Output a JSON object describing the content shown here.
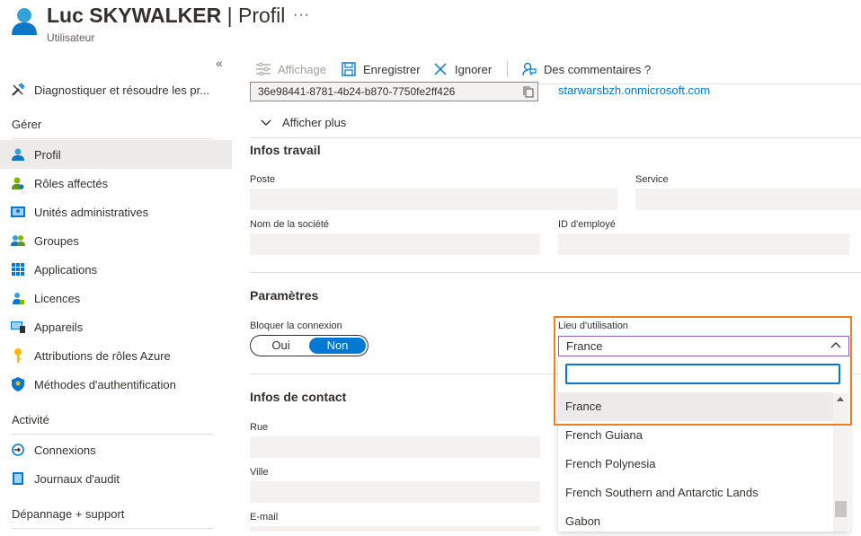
{
  "header": {
    "name": "Luc SKYWALKER",
    "separator": " | ",
    "section": "Profil",
    "subtitle": "Utilisateur",
    "more": "···"
  },
  "sidebar": {
    "collapse": "«",
    "top_item": {
      "label": "Diagnostiquer et résoudre les pr...",
      "icon": "wrench-icon"
    },
    "sections": [
      {
        "title": "Gérer"
      },
      {
        "title": "Activité"
      },
      {
        "title": "Dépannage + support"
      }
    ],
    "manage_items": [
      {
        "label": "Profil",
        "icon": "user-icon",
        "active": true
      },
      {
        "label": "Rôles affectés",
        "icon": "role-icon"
      },
      {
        "label": "Unités administratives",
        "icon": "admin-units-icon"
      },
      {
        "label": "Groupes",
        "icon": "groups-icon"
      },
      {
        "label": "Applications",
        "icon": "apps-grid-icon"
      },
      {
        "label": "Licences",
        "icon": "license-icon"
      },
      {
        "label": "Appareils",
        "icon": "device-icon"
      },
      {
        "label": "Attributions de rôles Azure",
        "icon": "key-icon"
      },
      {
        "label": "Méthodes d'authentification",
        "icon": "shield-icon"
      }
    ],
    "activity_items": [
      {
        "label": "Connexions",
        "icon": "signin-icon"
      },
      {
        "label": "Journaux d'audit",
        "icon": "audit-log-icon"
      }
    ]
  },
  "toolbar": {
    "view_label": "Affichage",
    "save_label": "Enregistrer",
    "discard_label": "Ignorer",
    "feedback_label": "Des commentaires ?"
  },
  "identity": {
    "object_id": "36e98441-8781-4b24-b870-7750fe2ff426",
    "domain": "starwarsbzh.onmicrosoft.com",
    "show_more": "Afficher plus"
  },
  "job_info": {
    "title": "Infos travail",
    "job_title_label": "Poste",
    "department_label": "Service",
    "company_label": "Nom de la société",
    "employee_id_label": "ID d'employé"
  },
  "settings": {
    "title": "Paramètres",
    "block_signin_label": "Bloquer la connexion",
    "toggle_yes": "Oui",
    "toggle_no": "Non",
    "toggle_selected": "Non",
    "usage_location_label": "Lieu d'utilisation",
    "usage_location_value": "France",
    "search_value": "",
    "options": [
      "France",
      "French Guiana",
      "French Polynesia",
      "French Southern and Antarctic Lands",
      "Gabon"
    ],
    "selected_option": "France"
  },
  "contact": {
    "title": "Infos de contact",
    "street_label": "Rue",
    "city_label": "Ville",
    "email_label": "E-mail"
  },
  "colors": {
    "accent": "#0078d4",
    "highlight_border": "#f07f23",
    "select_border": "#8764b8"
  }
}
